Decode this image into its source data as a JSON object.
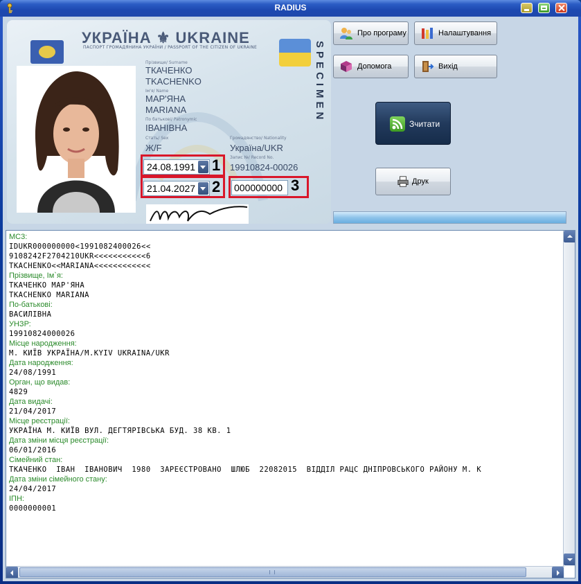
{
  "window": {
    "title": "RADIUS",
    "accent": "#1d49b1"
  },
  "card": {
    "title": "УКРАЇНА ⚜ UKRAINE",
    "subtitle": "ПАСПОРТ ГРОМАДЯНИНА УКРАЇНИ / PASSPORT OF THE CITIZEN OF UKRAINE",
    "specimen": "SPECIMEN",
    "fields": {
      "surname_label": "Прізвище/ Surname",
      "surname_ua": "ТКАЧЕНКО",
      "surname_en": "TKACHENKO",
      "name_label": "Ім'я/ Name",
      "name_ua": "МАР'ЯНА",
      "name_en": "MARIANA",
      "patronymic_label": "По батькові/ Patronymic",
      "patronymic": "ІВАНІВНА",
      "sex_label": "Стать/ Sex",
      "sex": "Ж/F",
      "nationality_label": "Громадянство/ Nationality",
      "nationality": "Україна/UKR",
      "record_label": "Запис №/ Record No.",
      "record": "19910824-00026"
    },
    "birth_date": "24.08.1991",
    "expiry_date": "21.04.2027",
    "doc_number": "000000000",
    "markers": [
      "1",
      "2",
      "3"
    ]
  },
  "buttons": {
    "about": "Про програму",
    "settings": "Налаштування",
    "help": "Допомога",
    "exit": "Вихід",
    "read": "Зчитати",
    "print": "Друк"
  },
  "output": {
    "lines": [
      {
        "t": "label",
        "text": "MC3:"
      },
      {
        "t": "value",
        "text": "IDUKR000000000<1991082400026<<"
      },
      {
        "t": "value",
        "text": "9108242F2704210UKR<<<<<<<<<<<6"
      },
      {
        "t": "value",
        "text": "TKACHENKO<<MARIANA<<<<<<<<<<<<"
      },
      {
        "t": "label",
        "text": "Прізвище, Ім`я:"
      },
      {
        "t": "value",
        "text": "ТКАЧЕНКО МАР'ЯНА"
      },
      {
        "t": "value",
        "text": "TKACHENKO MARIANA"
      },
      {
        "t": "label",
        "text": "По-батькові:"
      },
      {
        "t": "value",
        "text": "ВАСИЛІВНА"
      },
      {
        "t": "label",
        "text": "УНЗР:"
      },
      {
        "t": "value",
        "text": "19910824000026"
      },
      {
        "t": "label",
        "text": "Місце народження:"
      },
      {
        "t": "value",
        "text": "М. КИЇВ УКРАЇНА/M.KYIV UKRAINA/UKR"
      },
      {
        "t": "label",
        "text": "Дата народження:"
      },
      {
        "t": "value",
        "text": "24/08/1991"
      },
      {
        "t": "label",
        "text": "Орган, що видав:"
      },
      {
        "t": "value",
        "text": "4829"
      },
      {
        "t": "label",
        "text": "Дата видачі:"
      },
      {
        "t": "value",
        "text": "21/04/2017"
      },
      {
        "t": "label",
        "text": "Місце реєстрації:"
      },
      {
        "t": "value",
        "text": "УКРАЇНА М. КИЇВ ВУЛ. ДЕГТЯРІВСЬКА БУД. 38 КВ. 1"
      },
      {
        "t": "label",
        "text": "Дата зміни місця реєстрації:"
      },
      {
        "t": "value",
        "text": "06/01/2016"
      },
      {
        "t": "label",
        "text": "Сімейний стан:"
      },
      {
        "t": "value",
        "text": "ТКАЧЕНКО  ІВАН  ІВАНОВИЧ  1980  ЗАРЕЄСТРОВАНО  ШЛЮБ  22082015  ВІДДІЛ РАЦС ДНІПРОВСЬКОГО РАЙОНУ М. К"
      },
      {
        "t": "label",
        "text": "Дата зміни сімейного стану:"
      },
      {
        "t": "value",
        "text": "24/04/2017"
      },
      {
        "t": "label",
        "text": "ІПН:"
      },
      {
        "t": "value",
        "text": "0000000001"
      }
    ]
  }
}
